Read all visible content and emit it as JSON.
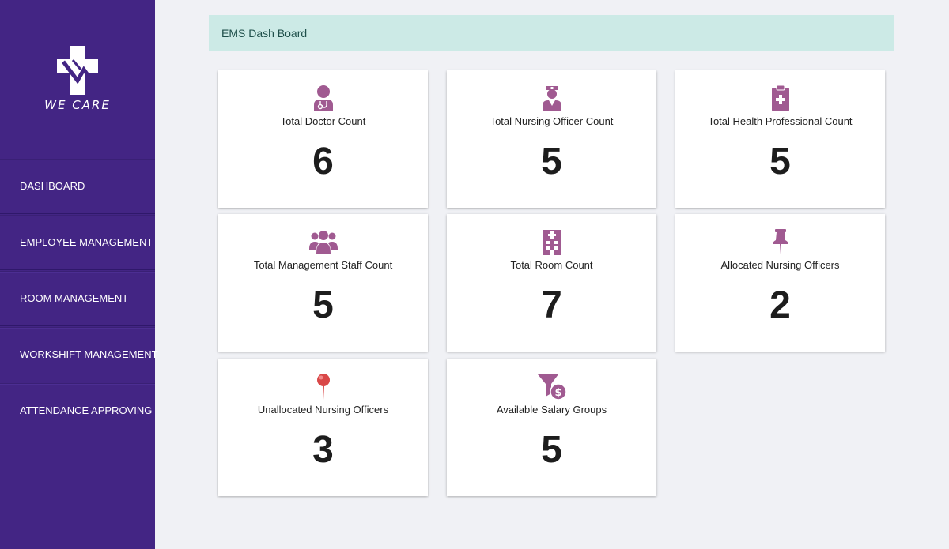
{
  "app": {
    "logo_text": "WE CARE"
  },
  "sidebar": {
    "items": [
      {
        "label": "DASHBOARD"
      },
      {
        "label": "EMPLOYEE MANAGEMENT"
      },
      {
        "label": "ROOM MANAGEMENT"
      },
      {
        "label": "WORKSHIFT MANAGEMENT"
      },
      {
        "label": "ATTENDANCE APPROVING"
      }
    ]
  },
  "header": {
    "title": "EMS Dash Board"
  },
  "cards": [
    {
      "label": "Total Doctor Count",
      "value": "6",
      "icon": "doctor-icon"
    },
    {
      "label": "Total Nursing Officer Count",
      "value": "5",
      "icon": "nurse-icon"
    },
    {
      "label": "Total Health Professional Count",
      "value": "5",
      "icon": "medical-clipboard-icon"
    },
    {
      "label": "Total Management Staff Count",
      "value": "5",
      "icon": "users-group-icon"
    },
    {
      "label": "Total Room Count",
      "value": "7",
      "icon": "hospital-building-icon"
    },
    {
      "label": "Allocated Nursing Officers",
      "value": "2",
      "icon": "pushpin-icon"
    },
    {
      "label": "Unallocated Nursing Officers",
      "value": "3",
      "icon": "map-pin-icon"
    },
    {
      "label": "Available Salary Groups",
      "value": "5",
      "icon": "salary-funnel-icon"
    }
  ],
  "colors": {
    "sidebar_bg": "#432584",
    "header_bg": "#cceae6",
    "icon_accent": "#a05a91",
    "pin_red": "#d94848",
    "page_bg": "#f0f1f5"
  }
}
